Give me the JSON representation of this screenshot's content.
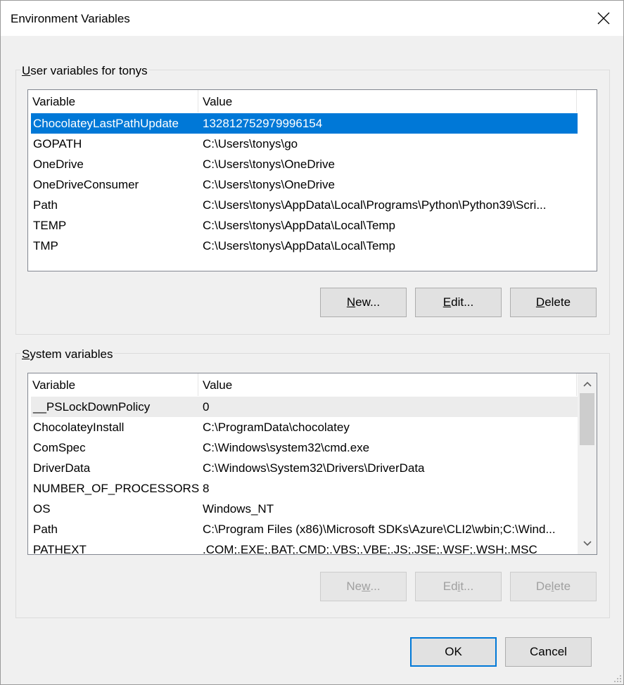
{
  "window": {
    "title": "Environment Variables"
  },
  "user_group": {
    "label_prefix": "",
    "label_underlined": "U",
    "label_rest": "ser variables for tonys",
    "columns": [
      "Variable",
      "Value"
    ],
    "rows": [
      {
        "variable": "ChocolateyLastPathUpdate",
        "value": "132812752979996154"
      },
      {
        "variable": "GOPATH",
        "value": "C:\\Users\\tonys\\go"
      },
      {
        "variable": "OneDrive",
        "value": "C:\\Users\\tonys\\OneDrive"
      },
      {
        "variable": "OneDriveConsumer",
        "value": "C:\\Users\\tonys\\OneDrive"
      },
      {
        "variable": "Path",
        "value": "C:\\Users\\tonys\\AppData\\Local\\Programs\\Python\\Python39\\Scri..."
      },
      {
        "variable": "TEMP",
        "value": "C:\\Users\\tonys\\AppData\\Local\\Temp"
      },
      {
        "variable": "TMP",
        "value": "C:\\Users\\tonys\\AppData\\Local\\Temp"
      }
    ],
    "buttons": {
      "new": {
        "underlined": "N",
        "rest": "ew..."
      },
      "edit": {
        "underlined": "E",
        "rest": "dit..."
      },
      "delete": {
        "underlined": "D",
        "rest": "elete"
      }
    }
  },
  "system_group": {
    "label_underlined": "S",
    "label_rest": "ystem variables",
    "columns": [
      "Variable",
      "Value"
    ],
    "rows": [
      {
        "variable": "__PSLockDownPolicy",
        "value": "0"
      },
      {
        "variable": "ChocolateyInstall",
        "value": "C:\\ProgramData\\chocolatey"
      },
      {
        "variable": "ComSpec",
        "value": "C:\\Windows\\system32\\cmd.exe"
      },
      {
        "variable": "DriverData",
        "value": "C:\\Windows\\System32\\Drivers\\DriverData"
      },
      {
        "variable": "NUMBER_OF_PROCESSORS",
        "value": "8"
      },
      {
        "variable": "OS",
        "value": "Windows_NT"
      },
      {
        "variable": "Path",
        "value": "C:\\Program Files (x86)\\Microsoft SDKs\\Azure\\CLI2\\wbin;C:\\Wind..."
      },
      {
        "variable": "PATHEXT",
        "value": ".COM;.EXE;.BAT;.CMD;.VBS;.VBE;.JS;.JSE;.WSF;.WSH;.MSC"
      }
    ],
    "buttons": {
      "new": {
        "before": "Ne",
        "underlined": "w",
        "rest": "..."
      },
      "edit": {
        "before": "Ed",
        "underlined": "i",
        "rest": "t..."
      },
      "delete": {
        "before": "De",
        "underlined": "l",
        "rest": "ete"
      }
    }
  },
  "footer": {
    "ok": "OK",
    "cancel": "Cancel"
  },
  "colors": {
    "selection": "#0078d7",
    "dialog_bg": "#f0f0f0",
    "default_border": "#0078d7"
  }
}
